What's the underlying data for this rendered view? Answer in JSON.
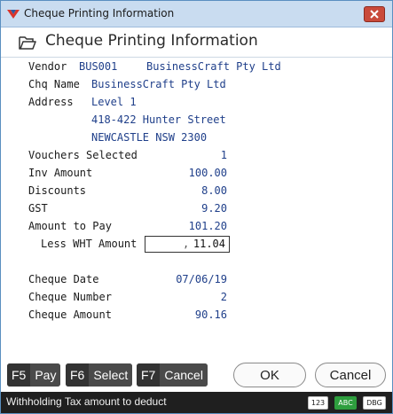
{
  "window": {
    "title": "Cheque Printing Information"
  },
  "header": {
    "title": "Cheque Printing Information"
  },
  "vendor": {
    "label": "Vendor",
    "code": "BUS001",
    "name": "BusinessCraft Pty Ltd",
    "chq_name_label": "Chq Name",
    "chq_name": "BusinessCraft Pty Ltd",
    "address_label": "Address",
    "address": [
      "Level 1",
      "418-422 Hunter Street",
      "NEWCASTLE NSW 2300"
    ]
  },
  "amounts": [
    {
      "label": "Vouchers Selected",
      "value": "1"
    },
    {
      "label": "Inv Amount",
      "value": "100.00"
    },
    {
      "label": "Discounts",
      "value": "8.00"
    },
    {
      "label": "GST",
      "value": "9.20"
    },
    {
      "label": "Amount to Pay",
      "value": "101.20"
    }
  ],
  "wht": {
    "label": "Less WHT Amount",
    "dot": ",",
    "value": "11.04"
  },
  "cheque": [
    {
      "label": "Cheque Date",
      "value": "07/06/19"
    },
    {
      "label": "Cheque Number",
      "value": "2"
    },
    {
      "label": "Cheque Amount",
      "value": "90.16"
    }
  ],
  "fkeys": [
    {
      "key": "F5",
      "label": "Pay"
    },
    {
      "key": "F6",
      "label": "Select"
    },
    {
      "key": "F7",
      "label": "Cancel"
    }
  ],
  "buttons": {
    "ok": "OK",
    "cancel": "Cancel"
  },
  "status": {
    "text": "Withholding Tax amount to deduct",
    "badges": [
      "123",
      "ABC",
      "DBG"
    ]
  },
  "colors": {
    "titlebar": "#c9dcf0",
    "value_text": "#1f3f8a",
    "close": "#c94a3a",
    "badge_abc": "#2e9e3e"
  }
}
